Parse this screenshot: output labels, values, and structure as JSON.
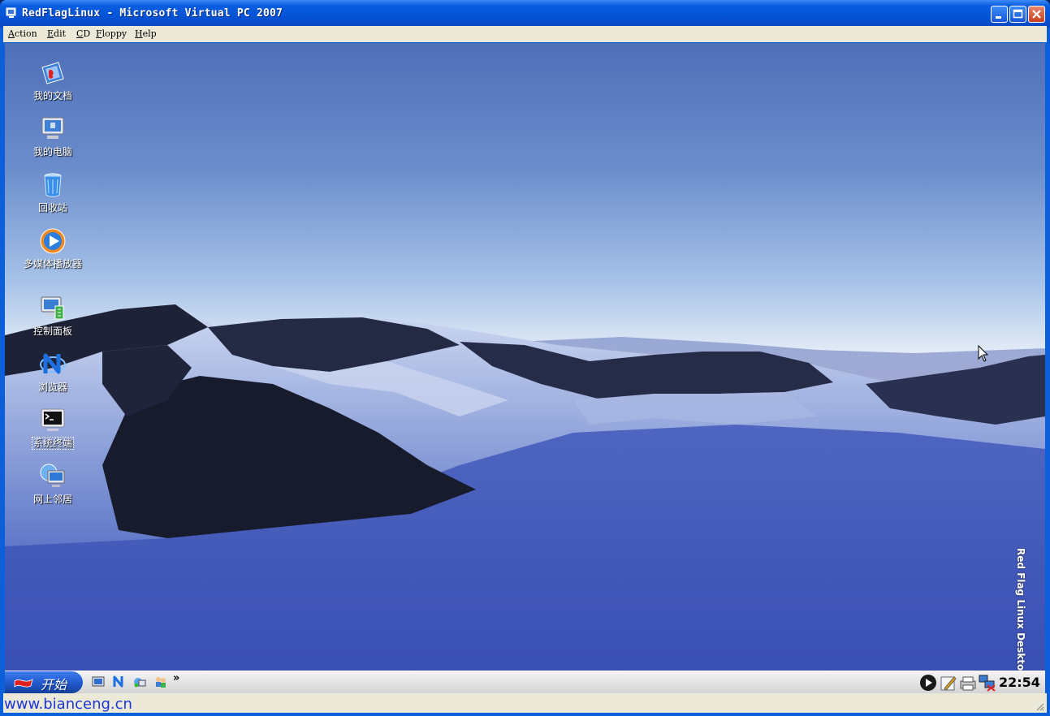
{
  "window": {
    "title": "RedFlagLinux - Microsoft Virtual PC 2007",
    "icon": "virtual-pc-icon",
    "colors": {
      "titlebar": "#0453d6",
      "close": "#c7401f"
    }
  },
  "menubar": {
    "items": [
      "Action",
      "Edit",
      "CD",
      "Floppy",
      "Help"
    ]
  },
  "desktop": {
    "icons": [
      {
        "label": "我的文档",
        "icon": "my-documents-icon"
      },
      {
        "label": "我的电脑",
        "icon": "my-computer-icon"
      },
      {
        "label": "回收站",
        "icon": "recycle-bin-icon"
      },
      {
        "label": "多媒体播放器",
        "icon": "media-player-icon"
      },
      {
        "label": "控制面板",
        "icon": "control-panel-icon"
      },
      {
        "label": "浏览器",
        "icon": "browser-icon"
      },
      {
        "label": "系统终端",
        "icon": "terminal-icon"
      },
      {
        "label": "网上邻居",
        "icon": "network-icon"
      }
    ],
    "branding": "Red Flag Linux Desktop"
  },
  "taskbar": {
    "start_label": "开始",
    "quicklaunch": [
      "show-desktop-icon",
      "browser-icon",
      "network-icon",
      "users-icon"
    ],
    "overflow": "»",
    "tray": [
      "media-icon",
      "edit-icon",
      "printer-icon",
      "network-status-icon"
    ],
    "clock": "22:54"
  },
  "statusbar": {
    "watermark": "www.bianceng.cn"
  }
}
